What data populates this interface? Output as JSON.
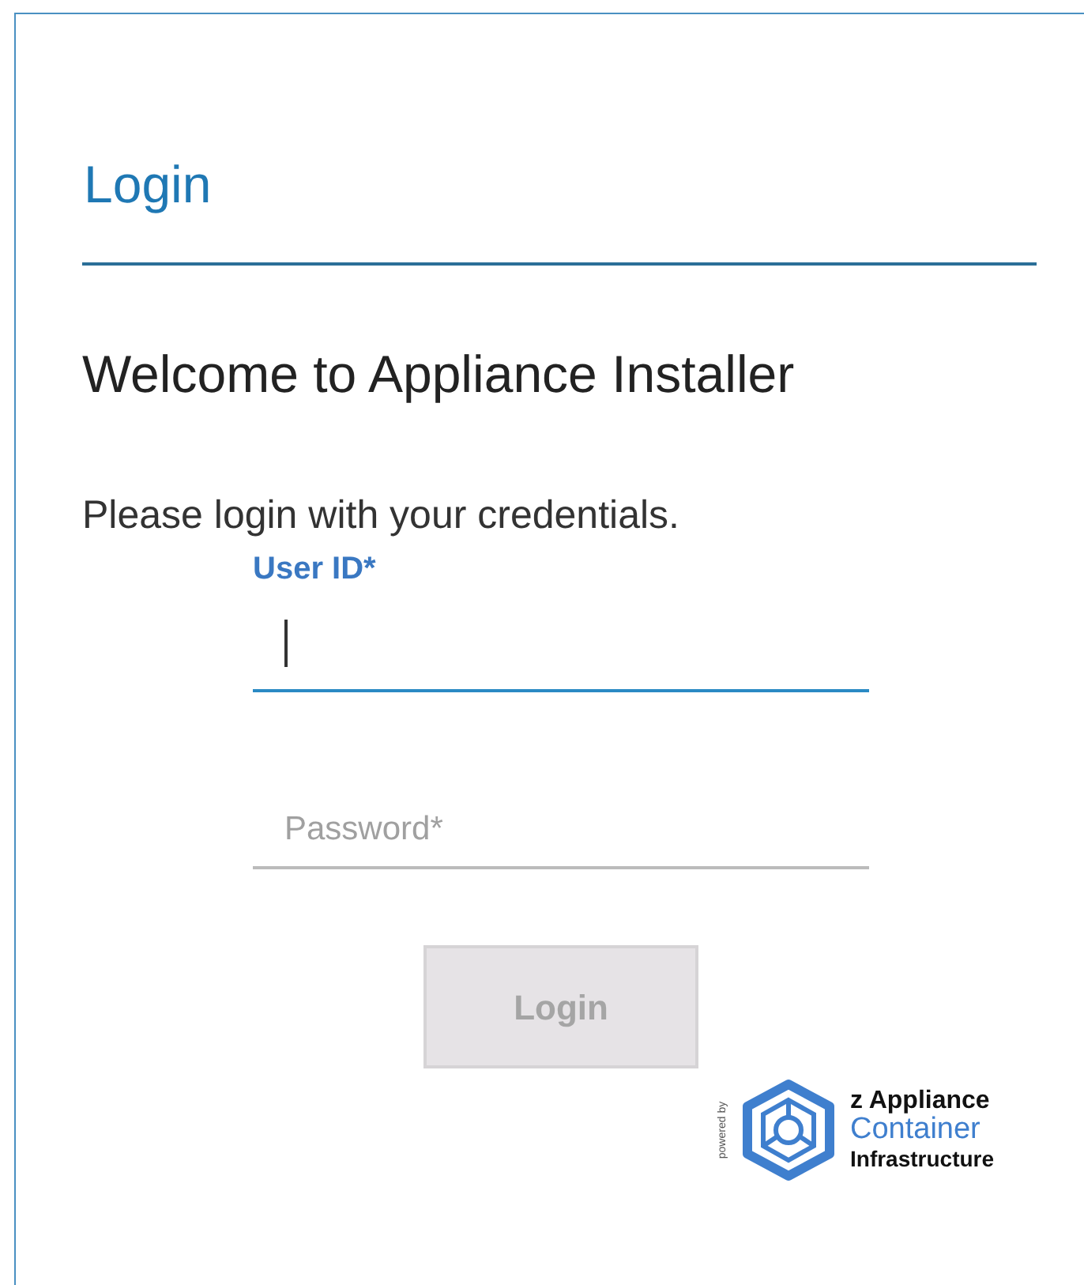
{
  "title": "Login",
  "welcome": "Welcome to Appliance Installer",
  "instruction": "Please login with your credentials.",
  "fields": [
    {
      "label": "User ID*",
      "focused": true
    },
    {
      "placeholder": "Password*",
      "focused": false
    }
  ],
  "button": {
    "label": "Login",
    "disabled": true
  },
  "logo": {
    "powered_by": "powered by",
    "lines": [
      "z Appliance",
      "Container",
      "Infrastructure"
    ]
  }
}
